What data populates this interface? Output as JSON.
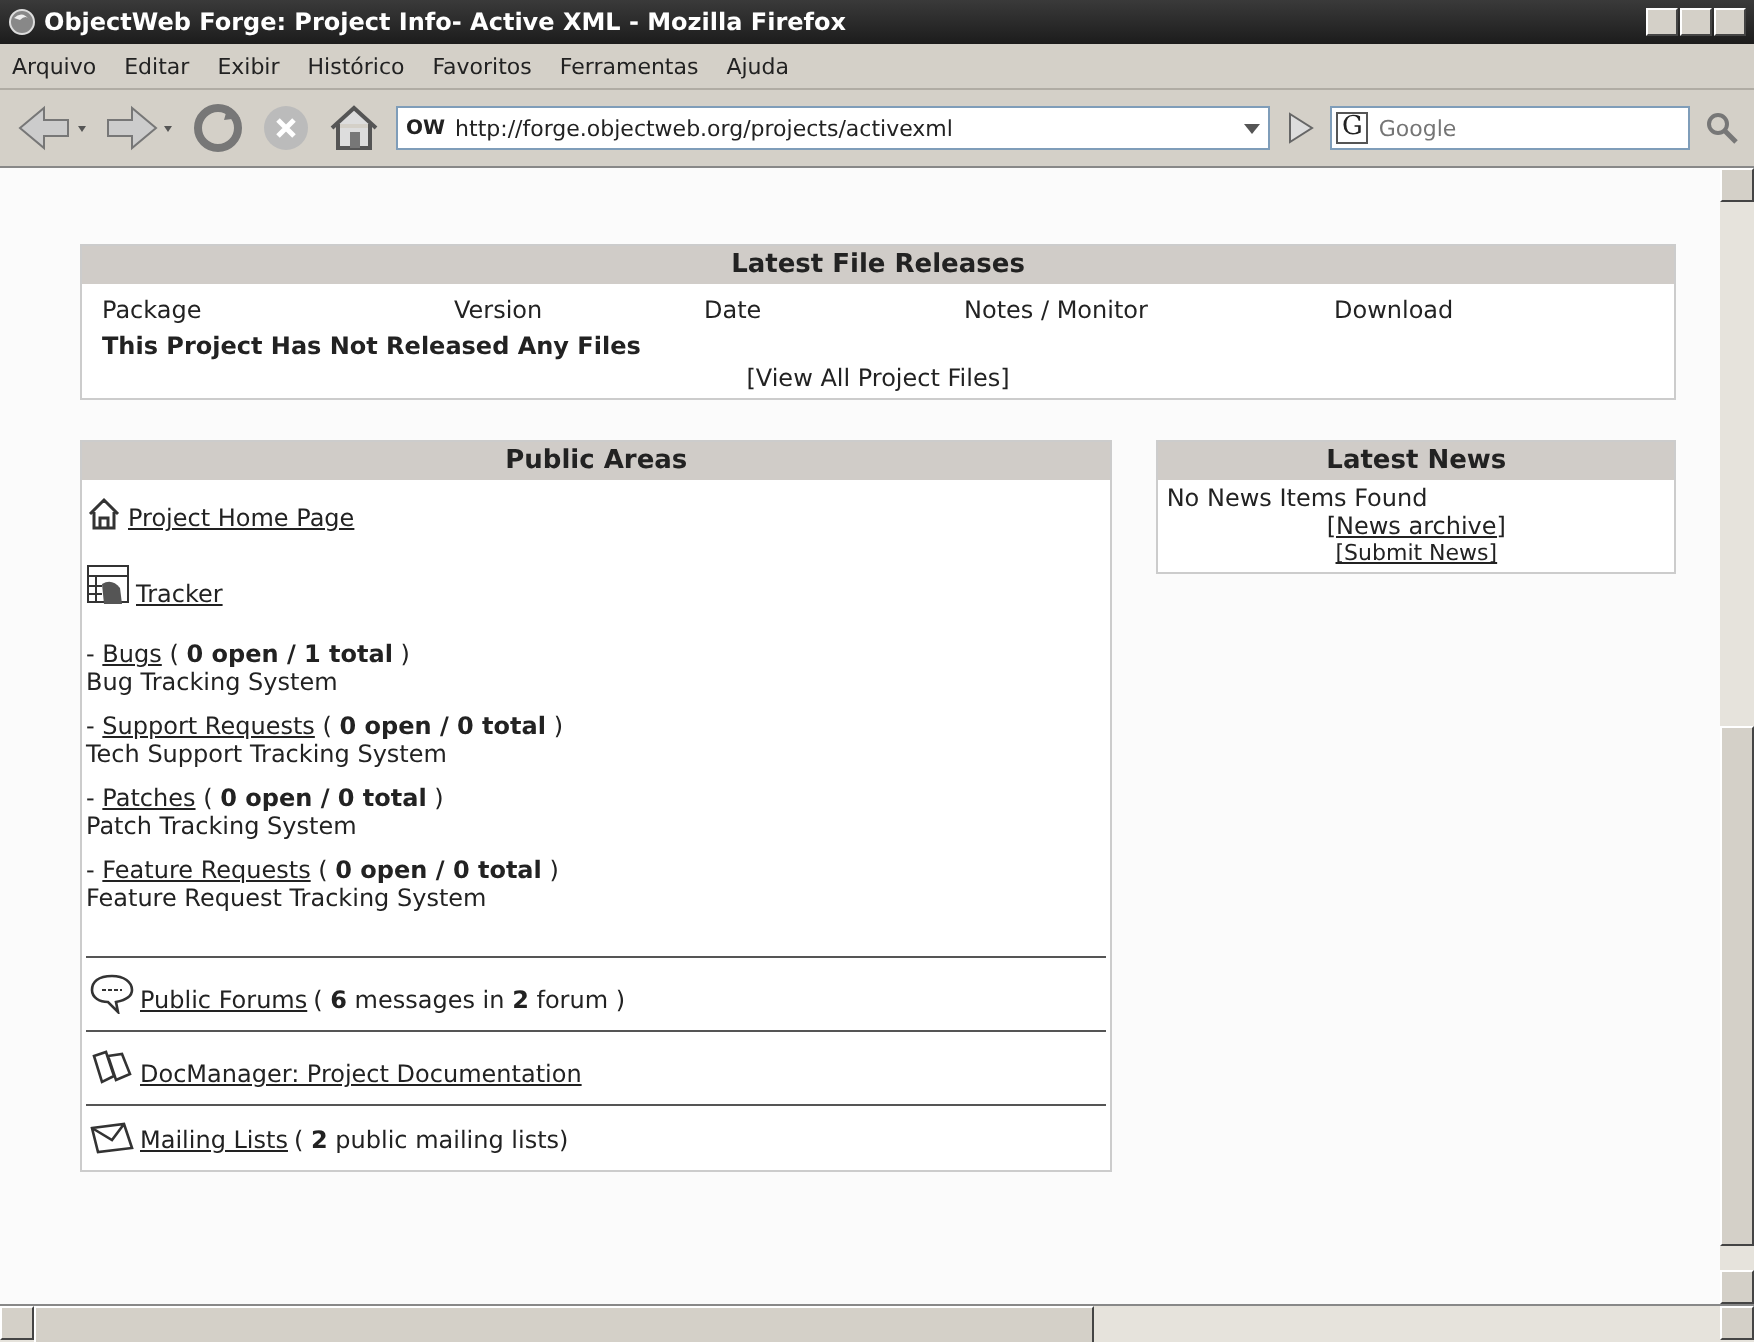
{
  "window": {
    "title": "ObjectWeb Forge: Project Info- Active XML - Mozilla Firefox"
  },
  "menu": [
    "Arquivo",
    "Editar",
    "Exibir",
    "Histórico",
    "Favoritos",
    "Ferramentas",
    "Ajuda"
  ],
  "toolbar": {
    "address": "http://forge.objectweb.org/projects/activexml",
    "site_badge": "OW",
    "search": {
      "placeholder": "Google"
    },
    "search_engine": "G"
  },
  "file_releases": {
    "title": "Latest File Releases",
    "columns": [
      "Package",
      "Version",
      "Date",
      "Notes / Monitor",
      "Download"
    ],
    "message": "This Project Has Not Released Any Files",
    "link": "[View All Project Files]"
  },
  "public_areas": {
    "title": "Public Areas",
    "sections": [
      {
        "kind": "home",
        "link": "Project Home Page"
      },
      {
        "kind": "tracker",
        "link": "Tracker",
        "trackers": [
          {
            "dash": "-",
            "name": "Bugs",
            "stats": "( **0 open / 1 total** )",
            "description": "Bug Tracking System"
          },
          {
            "dash": "-",
            "name": "Support Requests",
            "stats": "( **0 open / 0 total** )",
            "description": "Tech Support Tracking System"
          },
          {
            "dash": "-",
            "name": "Patches",
            "stats": "( **0 open / 0 total** )",
            "description": "Patch Tracking System"
          },
          {
            "dash": "-",
            "name": "Feature Requests",
            "stats": "( **0 open / 0 total** )",
            "description": "Feature Request Tracking System"
          }
        ]
      },
      {
        "kind": "forums",
        "link": "Public Forums",
        "stats": "( **6** messages in **2** forum )"
      },
      {
        "kind": "docs",
        "link": "DocManager: Project Documentation"
      },
      {
        "kind": "mail",
        "link": "Mailing Lists",
        "stats": "( **2** public mailing lists)"
      }
    ]
  },
  "latest_news": {
    "title": "Latest News",
    "message": "No News Items Found",
    "archive_link": "[News archive]",
    "submit_link": "[Submit News]"
  }
}
